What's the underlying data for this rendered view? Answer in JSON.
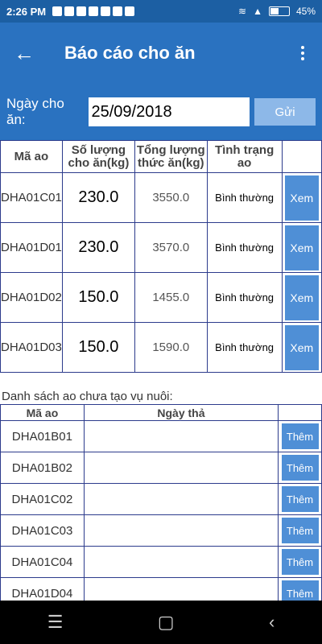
{
  "status_bar": {
    "time": "2:26 PM",
    "battery": "45%"
  },
  "app_bar": {
    "title": "Báo cáo cho ăn",
    "back_icon": "arrow-back-icon",
    "menu_icon": "more-vert-icon"
  },
  "date_row": {
    "label": "Ngày cho ăn:",
    "value": "25/09/2018",
    "send_label": "Gửi"
  },
  "feed_table": {
    "headers": [
      "Mã ao",
      "Số lượng cho ăn(kg)",
      "Tổng lượng thức ăn(kg)",
      "Tình trạng ao"
    ],
    "rows": [
      {
        "code": "DHA01C01",
        "amount": "230.0",
        "total": "3550.0",
        "status": "Bình thường",
        "action": "Xem"
      },
      {
        "code": "DHA01D01",
        "amount": "230.0",
        "total": "3570.0",
        "status": "Bình thường",
        "action": "Xem"
      },
      {
        "code": "DHA01D02",
        "amount": "150.0",
        "total": "1455.0",
        "status": "Bình thường",
        "action": "Xem"
      },
      {
        "code": "DHA01D03",
        "amount": "150.0",
        "total": "1590.0",
        "status": "Bình thường",
        "action": "Xem"
      }
    ]
  },
  "pond_section": {
    "label": "Danh sách ao chưa tạo vụ nuôi:",
    "headers": [
      "Mã ao",
      "Ngày thả"
    ],
    "rows": [
      {
        "code": "DHA01B01",
        "date": "",
        "action": "Thêm"
      },
      {
        "code": "DHA01B02",
        "date": "",
        "action": "Thêm"
      },
      {
        "code": "DHA01C02",
        "date": "",
        "action": "Thêm"
      },
      {
        "code": "DHA01C03",
        "date": "",
        "action": "Thêm"
      },
      {
        "code": "DHA01C04",
        "date": "",
        "action": "Thêm"
      },
      {
        "code": "DHA01D04",
        "date": "",
        "action": "Thêm"
      }
    ]
  },
  "nav_bar": {
    "menu": "☰",
    "home": "▢",
    "back": "‹"
  }
}
